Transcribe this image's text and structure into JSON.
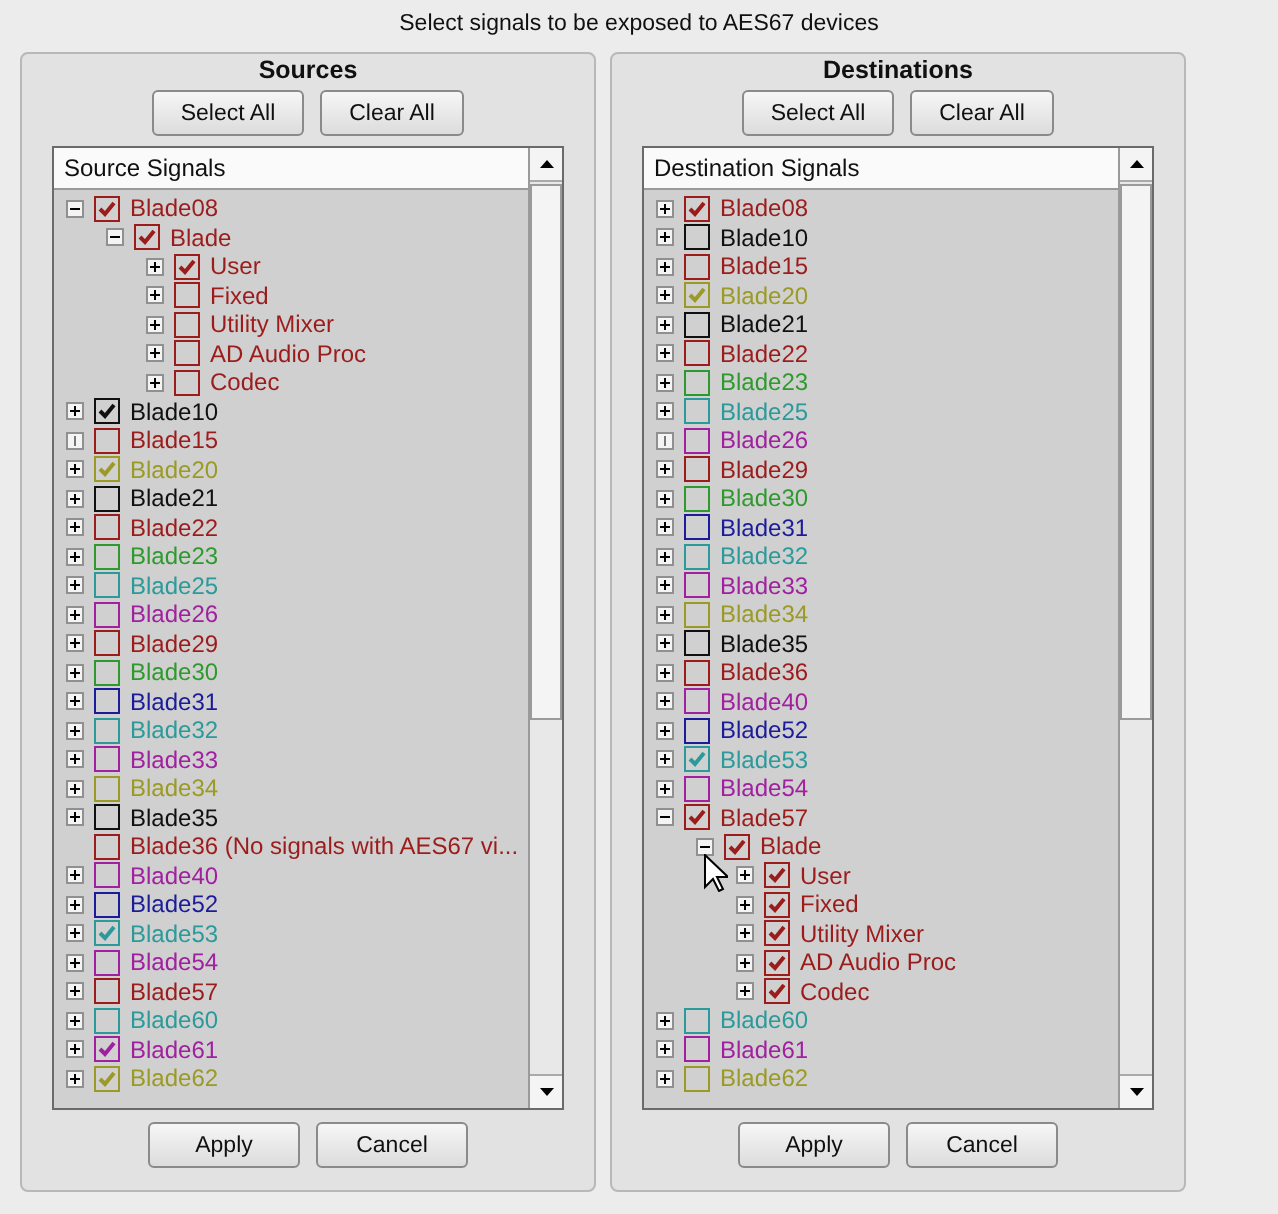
{
  "title": "Select signals to be exposed to AES67 devices",
  "panels": [
    {
      "heading": "Sources",
      "top_buttons": [
        "Select All",
        "Clear All"
      ],
      "tree": {
        "header": "Source Signals",
        "items": [
          {
            "label": "Blade08",
            "color": "#9c1c1c",
            "checked": true,
            "kind": "branch",
            "expanded": true,
            "children": [
              {
                "label": "Blade",
                "color": "#9c1c1c",
                "checked": true,
                "kind": "branch",
                "expanded": true,
                "children": [
                  {
                    "label": "User",
                    "color": "#9c1c1c",
                    "checked": true,
                    "kind": "branch",
                    "expanded": false
                  },
                  {
                    "label": "Fixed",
                    "color": "#9c1c1c",
                    "checked": false,
                    "kind": "branch",
                    "expanded": false
                  },
                  {
                    "label": "Utility Mixer",
                    "color": "#9c1c1c",
                    "checked": false,
                    "kind": "branch",
                    "expanded": false
                  },
                  {
                    "label": "AD Audio Proc",
                    "color": "#9c1c1c",
                    "checked": false,
                    "kind": "branch",
                    "expanded": false
                  },
                  {
                    "label": "Codec",
                    "color": "#9c1c1c",
                    "checked": false,
                    "kind": "branch",
                    "expanded": false
                  }
                ]
              }
            ]
          },
          {
            "label": "Blade10",
            "color": "#101010",
            "checked": true,
            "kind": "branch",
            "expanded": false
          },
          {
            "label": "Blade15",
            "color": "#9c1c1c",
            "checked": false,
            "kind": "empty"
          },
          {
            "label": "Blade20",
            "color": "#9a9a24",
            "checked": true,
            "kind": "branch",
            "expanded": false
          },
          {
            "label": "Blade21",
            "color": "#101010",
            "checked": false,
            "kind": "branch",
            "expanded": false
          },
          {
            "label": "Blade22",
            "color": "#9c1c1c",
            "checked": false,
            "kind": "branch",
            "expanded": false
          },
          {
            "label": "Blade23",
            "color": "#2e9a2e",
            "checked": false,
            "kind": "branch",
            "expanded": false
          },
          {
            "label": "Blade25",
            "color": "#2a9a9a",
            "checked": false,
            "kind": "branch",
            "expanded": false
          },
          {
            "label": "Blade26",
            "color": "#a020a0",
            "checked": false,
            "kind": "branch",
            "expanded": false
          },
          {
            "label": "Blade29",
            "color": "#9c1c1c",
            "checked": false,
            "kind": "branch",
            "expanded": false
          },
          {
            "label": "Blade30",
            "color": "#2e9a2e",
            "checked": false,
            "kind": "branch",
            "expanded": false
          },
          {
            "label": "Blade31",
            "color": "#1c1c9a",
            "checked": false,
            "kind": "branch",
            "expanded": false
          },
          {
            "label": "Blade32",
            "color": "#2a9a9a",
            "checked": false,
            "kind": "branch",
            "expanded": false
          },
          {
            "label": "Blade33",
            "color": "#a020a0",
            "checked": false,
            "kind": "branch",
            "expanded": false
          },
          {
            "label": "Blade34",
            "color": "#9a9a24",
            "checked": false,
            "kind": "branch",
            "expanded": false
          },
          {
            "label": "Blade35",
            "color": "#101010",
            "checked": false,
            "kind": "branch",
            "expanded": false
          },
          {
            "label": "Blade36 (No signals with AES67 vi...",
            "color": "#9c1c1c",
            "checked": false,
            "kind": "leaf"
          },
          {
            "label": "Blade40",
            "color": "#a020a0",
            "checked": false,
            "kind": "branch",
            "expanded": false
          },
          {
            "label": "Blade52",
            "color": "#1c1c9a",
            "checked": false,
            "kind": "branch",
            "expanded": false
          },
          {
            "label": "Blade53",
            "color": "#2a9a9a",
            "checked": true,
            "kind": "branch",
            "expanded": false
          },
          {
            "label": "Blade54",
            "color": "#a020a0",
            "checked": false,
            "kind": "branch",
            "expanded": false
          },
          {
            "label": "Blade57",
            "color": "#9c1c1c",
            "checked": false,
            "kind": "branch",
            "expanded": false
          },
          {
            "label": "Blade60",
            "color": "#2a9a9a",
            "checked": false,
            "kind": "branch",
            "expanded": false
          },
          {
            "label": "Blade61",
            "color": "#a020a0",
            "checked": true,
            "kind": "branch",
            "expanded": false
          },
          {
            "label": "Blade62",
            "color": "#9a9a24",
            "checked": true,
            "kind": "branch",
            "expanded": false
          }
        ]
      },
      "bottom_buttons": [
        "Apply",
        "Cancel"
      ]
    },
    {
      "heading": "Destinations",
      "top_buttons": [
        "Select All",
        "Clear All"
      ],
      "tree": {
        "header": "Destination Signals",
        "items": [
          {
            "label": "Blade08",
            "color": "#9c1c1c",
            "checked": true,
            "kind": "branch",
            "expanded": false
          },
          {
            "label": "Blade10",
            "color": "#101010",
            "checked": false,
            "kind": "branch",
            "expanded": false
          },
          {
            "label": "Blade15",
            "color": "#9c1c1c",
            "checked": false,
            "kind": "branch",
            "expanded": false
          },
          {
            "label": "Blade20",
            "color": "#9a9a24",
            "checked": true,
            "kind": "branch",
            "expanded": false
          },
          {
            "label": "Blade21",
            "color": "#101010",
            "checked": false,
            "kind": "branch",
            "expanded": false
          },
          {
            "label": "Blade22",
            "color": "#9c1c1c",
            "checked": false,
            "kind": "branch",
            "expanded": false
          },
          {
            "label": "Blade23",
            "color": "#2e9a2e",
            "checked": false,
            "kind": "branch",
            "expanded": false
          },
          {
            "label": "Blade25",
            "color": "#2a9a9a",
            "checked": false,
            "kind": "branch",
            "expanded": false
          },
          {
            "label": "Blade26",
            "color": "#a020a0",
            "checked": false,
            "kind": "empty"
          },
          {
            "label": "Blade29",
            "color": "#9c1c1c",
            "checked": false,
            "kind": "branch",
            "expanded": false
          },
          {
            "label": "Blade30",
            "color": "#2e9a2e",
            "checked": false,
            "kind": "branch",
            "expanded": false
          },
          {
            "label": "Blade31",
            "color": "#1c1c9a",
            "checked": false,
            "kind": "branch",
            "expanded": false
          },
          {
            "label": "Blade32",
            "color": "#2a9a9a",
            "checked": false,
            "kind": "branch",
            "expanded": false
          },
          {
            "label": "Blade33",
            "color": "#a020a0",
            "checked": false,
            "kind": "branch",
            "expanded": false
          },
          {
            "label": "Blade34",
            "color": "#9a9a24",
            "checked": false,
            "kind": "branch",
            "expanded": false
          },
          {
            "label": "Blade35",
            "color": "#101010",
            "checked": false,
            "kind": "branch",
            "expanded": false
          },
          {
            "label": "Blade36",
            "color": "#9c1c1c",
            "checked": false,
            "kind": "branch",
            "expanded": false
          },
          {
            "label": "Blade40",
            "color": "#a020a0",
            "checked": false,
            "kind": "branch",
            "expanded": false
          },
          {
            "label": "Blade52",
            "color": "#1c1c9a",
            "checked": false,
            "kind": "branch",
            "expanded": false
          },
          {
            "label": "Blade53",
            "color": "#2a9a9a",
            "checked": true,
            "kind": "branch",
            "expanded": false
          },
          {
            "label": "Blade54",
            "color": "#a020a0",
            "checked": false,
            "kind": "branch",
            "expanded": false
          },
          {
            "label": "Blade57",
            "color": "#9c1c1c",
            "checked": true,
            "kind": "branch",
            "expanded": true,
            "children": [
              {
                "label": "Blade",
                "color": "#9c1c1c",
                "checked": true,
                "kind": "branch",
                "expanded": true,
                "children": [
                  {
                    "label": "User",
                    "color": "#9c1c1c",
                    "checked": true,
                    "kind": "branch",
                    "expanded": false
                  },
                  {
                    "label": "Fixed",
                    "color": "#9c1c1c",
                    "checked": true,
                    "kind": "branch",
                    "expanded": false
                  },
                  {
                    "label": "Utility Mixer",
                    "color": "#9c1c1c",
                    "checked": true,
                    "kind": "branch",
                    "expanded": false
                  },
                  {
                    "label": "AD Audio Proc",
                    "color": "#9c1c1c",
                    "checked": true,
                    "kind": "branch",
                    "expanded": false
                  },
                  {
                    "label": "Codec",
                    "color": "#9c1c1c",
                    "checked": true,
                    "kind": "branch",
                    "expanded": false
                  }
                ]
              }
            ]
          },
          {
            "label": "Blade60",
            "color": "#2a9a9a",
            "checked": false,
            "kind": "branch",
            "expanded": false
          },
          {
            "label": "Blade61",
            "color": "#a020a0",
            "checked": false,
            "kind": "branch",
            "expanded": false
          },
          {
            "label": "Blade62",
            "color": "#9a9a24",
            "checked": false,
            "kind": "branch",
            "expanded": false
          }
        ]
      },
      "bottom_buttons": [
        "Apply",
        "Cancel"
      ]
    }
  ]
}
